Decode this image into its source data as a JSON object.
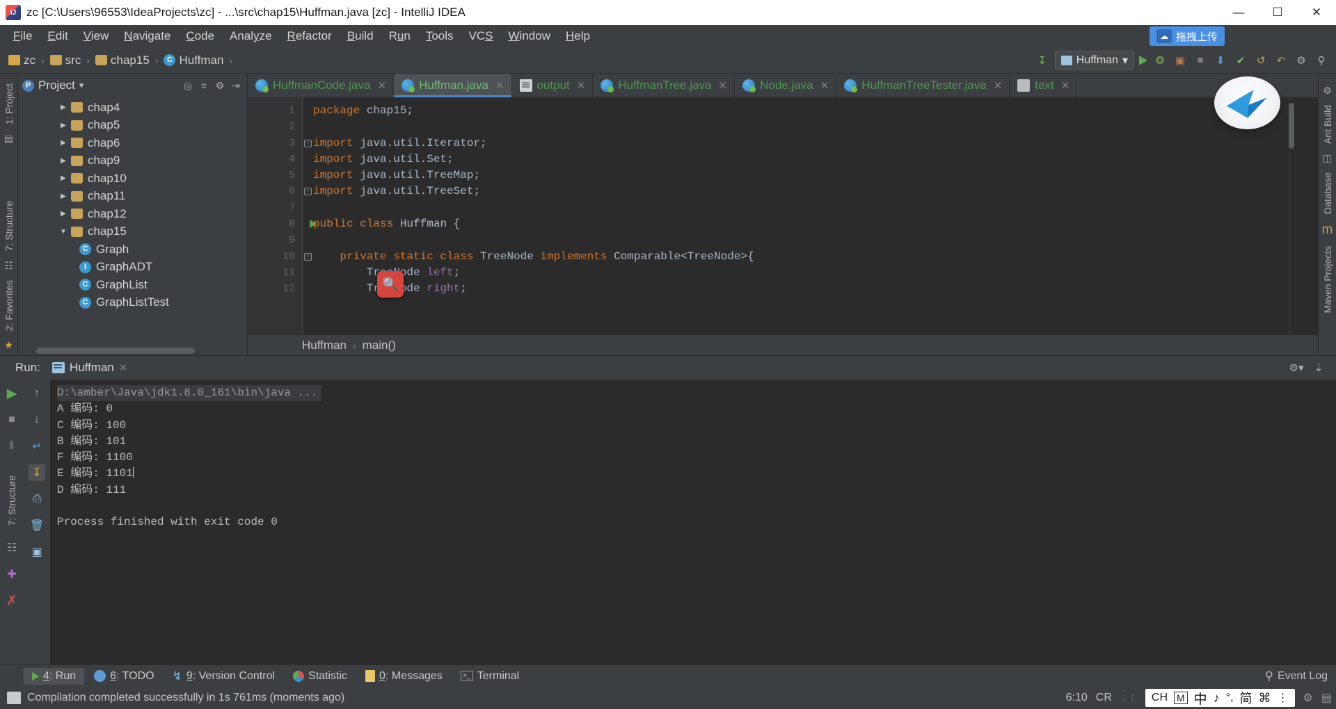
{
  "window": {
    "title": "zc [C:\\Users\\96553\\IdeaProjects\\zc] - ...\\src\\chap15\\Huffman.java [zc] - IntelliJ IDEA",
    "app_icon": "intellij-idea-icon",
    "minimize": "—",
    "maximize": "☐",
    "close": "✕"
  },
  "menubar": {
    "items": [
      {
        "label": "File",
        "mnemonic": "F"
      },
      {
        "label": "Edit",
        "mnemonic": "E"
      },
      {
        "label": "View",
        "mnemonic": "V"
      },
      {
        "label": "Navigate",
        "mnemonic": "N"
      },
      {
        "label": "Code",
        "mnemonic": "C"
      },
      {
        "label": "Analyze",
        "mnemonic": "y"
      },
      {
        "label": "Refactor",
        "mnemonic": "R"
      },
      {
        "label": "Build",
        "mnemonic": "B"
      },
      {
        "label": "Run",
        "mnemonic": "u"
      },
      {
        "label": "Tools",
        "mnemonic": "T"
      },
      {
        "label": "VCS",
        "mnemonic": "S"
      },
      {
        "label": "Window",
        "mnemonic": "W"
      },
      {
        "label": "Help",
        "mnemonic": "H"
      }
    ],
    "upload_button": {
      "label": "拖拽上传",
      "icon": "cloud-upload-icon"
    }
  },
  "navbar": {
    "breadcrumbs": [
      {
        "label": "zc",
        "icon": "module-icon"
      },
      {
        "label": "src",
        "icon": "folder-icon"
      },
      {
        "label": "chap15",
        "icon": "folder-icon"
      },
      {
        "label": "Huffman",
        "icon": "java-class-icon"
      }
    ],
    "separator": "›",
    "run_config": "Huffman",
    "run_config_chevron": "▾",
    "actions": [
      {
        "name": "update-project-icon",
        "glyph": "↧"
      },
      {
        "name": "run-icon",
        "glyph": "▶"
      },
      {
        "name": "debug-icon",
        "glyph": "✸"
      },
      {
        "name": "coverage-icon",
        "glyph": "▣"
      },
      {
        "name": "stop-icon",
        "glyph": "■"
      },
      {
        "name": "vcs-update-icon",
        "glyph": "⬇"
      },
      {
        "name": "vcs-commit-icon",
        "glyph": "✔"
      },
      {
        "name": "vcs-rollback-icon",
        "glyph": "↺"
      },
      {
        "name": "undo-icon",
        "glyph": "↶"
      },
      {
        "name": "settings-icon",
        "glyph": "⚙"
      },
      {
        "name": "search-icon",
        "glyph": "⚲"
      }
    ]
  },
  "left_rail": {
    "top_items": [
      {
        "label": "1: Project"
      }
    ],
    "bottom_items": [
      {
        "label": "7: Structure"
      },
      {
        "label": "2: Favorites"
      }
    ],
    "icons": [
      {
        "name": "ant-build-icon",
        "glyph": "◧"
      },
      {
        "name": "structure-icon",
        "glyph": "≣"
      }
    ]
  },
  "project_panel": {
    "title": "Project",
    "chevron": "▾",
    "actions": [
      {
        "name": "target-icon",
        "glyph": "⌖"
      },
      {
        "name": "expand-collapse-icon",
        "glyph": "≡"
      },
      {
        "name": "settings-icon",
        "glyph": "⚙"
      },
      {
        "name": "hide-icon",
        "glyph": "⇥"
      }
    ],
    "tree": [
      {
        "label": "chap4",
        "icon": "folder-icon",
        "arrow": "▶",
        "type": "folder",
        "indent": 1
      },
      {
        "label": "chap5",
        "icon": "folder-icon",
        "arrow": "▶",
        "type": "folder",
        "indent": 1
      },
      {
        "label": "chap6",
        "icon": "folder-icon",
        "arrow": "▶",
        "type": "folder",
        "indent": 1
      },
      {
        "label": "chap9",
        "icon": "folder-icon",
        "arrow": "▶",
        "type": "folder",
        "indent": 1
      },
      {
        "label": "chap10",
        "icon": "folder-icon",
        "arrow": "▶",
        "type": "folder",
        "indent": 1
      },
      {
        "label": "chap11",
        "icon": "folder-icon",
        "arrow": "▶",
        "type": "folder",
        "indent": 1
      },
      {
        "label": "chap12",
        "icon": "folder-icon",
        "arrow": "▶",
        "type": "folder",
        "indent": 1
      },
      {
        "label": "chap15",
        "icon": "folder-icon",
        "arrow": "▼",
        "type": "folder",
        "indent": 1
      },
      {
        "label": "Graph",
        "icon": "java-class-icon",
        "arrow": "",
        "type": "class",
        "indent": 2
      },
      {
        "label": "GraphADT",
        "icon": "java-interface-icon",
        "arrow": "",
        "type": "interface",
        "indent": 2
      },
      {
        "label": "GraphList",
        "icon": "java-class-icon",
        "arrow": "",
        "type": "class",
        "indent": 2
      },
      {
        "label": "GraphListTest",
        "icon": "java-runnable-icon",
        "arrow": "",
        "type": "runnable",
        "indent": 2
      }
    ]
  },
  "editor": {
    "tabs": [
      {
        "label": "HuffmanCode.java",
        "icon": "java-file-icon",
        "active": false,
        "close": "✕"
      },
      {
        "label": "Huffman.java",
        "icon": "java-file-icon",
        "active": true,
        "close": "✕"
      },
      {
        "label": "output",
        "icon": "text-file-icon",
        "active": false,
        "close": "✕"
      },
      {
        "label": "HuffmanTree.java",
        "icon": "java-file-icon",
        "active": false,
        "close": "✕"
      },
      {
        "label": "Node.java",
        "icon": "java-file-icon",
        "active": false,
        "close": "✕"
      },
      {
        "label": "HuffmanTreeTester.java",
        "icon": "java-file-icon",
        "active": false,
        "close": "✕"
      },
      {
        "label": "text",
        "icon": "text-file-icon",
        "active": false,
        "close": "✕"
      }
    ],
    "lines": [
      {
        "no": "1",
        "text": "package chap15;",
        "kw": "package",
        "fold": false,
        "run": false
      },
      {
        "no": "2",
        "text": "",
        "kw": "",
        "fold": false,
        "run": false
      },
      {
        "no": "3",
        "text": "import java.util.Iterator;",
        "kw": "import",
        "fold": true,
        "run": false
      },
      {
        "no": "4",
        "text": "import java.util.Set;",
        "kw": "import",
        "fold": false,
        "run": false
      },
      {
        "no": "5",
        "text": "import java.util.TreeMap;",
        "kw": "import",
        "fold": false,
        "run": false
      },
      {
        "no": "6",
        "text": "import java.util.TreeSet;",
        "kw": "import",
        "fold": true,
        "run": false
      },
      {
        "no": "7",
        "text": "",
        "kw": "",
        "fold": false,
        "run": false
      },
      {
        "no": "8",
        "text": "public class Huffman {",
        "kw": "public class",
        "fold": false,
        "run": true
      },
      {
        "no": "9",
        "text": "",
        "kw": "",
        "fold": false,
        "run": false
      },
      {
        "no": "10",
        "text": "    private static class TreeNode implements Comparable<TreeNode>{",
        "kw": "private static class",
        "fold": true,
        "run": false
      },
      {
        "no": "11",
        "text": "        TreeNode left;",
        "kw": "",
        "fold": false,
        "run": false
      },
      {
        "no": "12",
        "text": "        TreeNode right;",
        "kw": "",
        "fold": false,
        "run": false
      }
    ],
    "breadcrumb": [
      "Huffman",
      "main()"
    ],
    "breadcrumb_sep": "›",
    "magnifier_badge": "search-badge-icon"
  },
  "right_rail": {
    "items": [
      {
        "label": "Ant Build"
      },
      {
        "label": "Database"
      },
      {
        "label": "Maven Projects"
      }
    ],
    "maven_glyph": "m"
  },
  "run_panel": {
    "label": "Run:",
    "tab": {
      "label": "Huffman",
      "icon": "run-config-icon",
      "close": "✕"
    },
    "header_actions": [
      {
        "name": "settings-icon",
        "glyph": "⚙"
      },
      {
        "name": "export-icon",
        "glyph": "⤓"
      }
    ],
    "side_actions": [
      {
        "name": "rerun-icon",
        "glyph": "▶"
      },
      {
        "name": "stop-icon",
        "glyph": "■"
      },
      {
        "name": "pause-icon",
        "glyph": "‖"
      },
      {
        "name": "trace-up-icon",
        "glyph": "↑"
      },
      {
        "name": "trace-down-icon",
        "glyph": "↓"
      },
      {
        "name": "soft-wrap-icon",
        "glyph": "↵"
      },
      {
        "name": "scroll-end-icon",
        "glyph": "↧"
      },
      {
        "name": "print-icon",
        "glyph": "⎙"
      },
      {
        "name": "clear-all-icon",
        "glyph": "Ὕ1"
      }
    ],
    "console": [
      {
        "text": "D:\\amber\\Java\\jdk1.8.0_161\\bin\\java ...",
        "type": "command"
      },
      {
        "text": "A 编码: 0",
        "type": "out"
      },
      {
        "text": "C 编码: 100",
        "type": "out"
      },
      {
        "text": "B 编码: 101",
        "type": "out"
      },
      {
        "text": "F 编码: 1100",
        "type": "out"
      },
      {
        "text": "E 编码: 1101",
        "type": "out",
        "caret": true
      },
      {
        "text": "D 编码: 111",
        "type": "out"
      },
      {
        "text": "",
        "type": "out"
      },
      {
        "text": "Process finished with exit code 0",
        "type": "out"
      }
    ]
  },
  "tool_windows": [
    {
      "label": "4: Run",
      "num": "4",
      "rest": ": Run",
      "icon": "run-icon",
      "active": true
    },
    {
      "label": "6: TODO",
      "num": "6",
      "rest": ": TODO",
      "icon": "todo-icon",
      "active": false
    },
    {
      "label": "9: Version Control",
      "num": "9",
      "rest": ": Version Control",
      "icon": "version-control-icon",
      "active": false
    },
    {
      "label": "Statistic",
      "num": "",
      "rest": "Statistic",
      "icon": "statistic-icon",
      "active": false
    },
    {
      "label": "0: Messages",
      "num": "0",
      "rest": ": Messages",
      "icon": "messages-icon",
      "active": false
    },
    {
      "label": "Terminal",
      "num": "",
      "rest": "Terminal",
      "icon": "terminal-icon",
      "active": false
    }
  ],
  "event_log": {
    "label": "Event Log",
    "icon": "event-log-icon"
  },
  "status_bar": {
    "message": "Compilation completed successfully in 1s 761ms (moments ago)",
    "icon": "build-icon",
    "caret_position": "6:10",
    "line_separator": "CR",
    "ime": {
      "lang": "CH",
      "mode": "M",
      "chinese": "中",
      "note": "♪",
      "punct": "°,",
      "simplified": "简",
      "toolbox": "⌘",
      "more": "⋮"
    },
    "right_icons": [
      {
        "name": "help-icon",
        "glyph": "⚙"
      },
      {
        "name": "memory-icon",
        "glyph": "☷"
      }
    ]
  }
}
